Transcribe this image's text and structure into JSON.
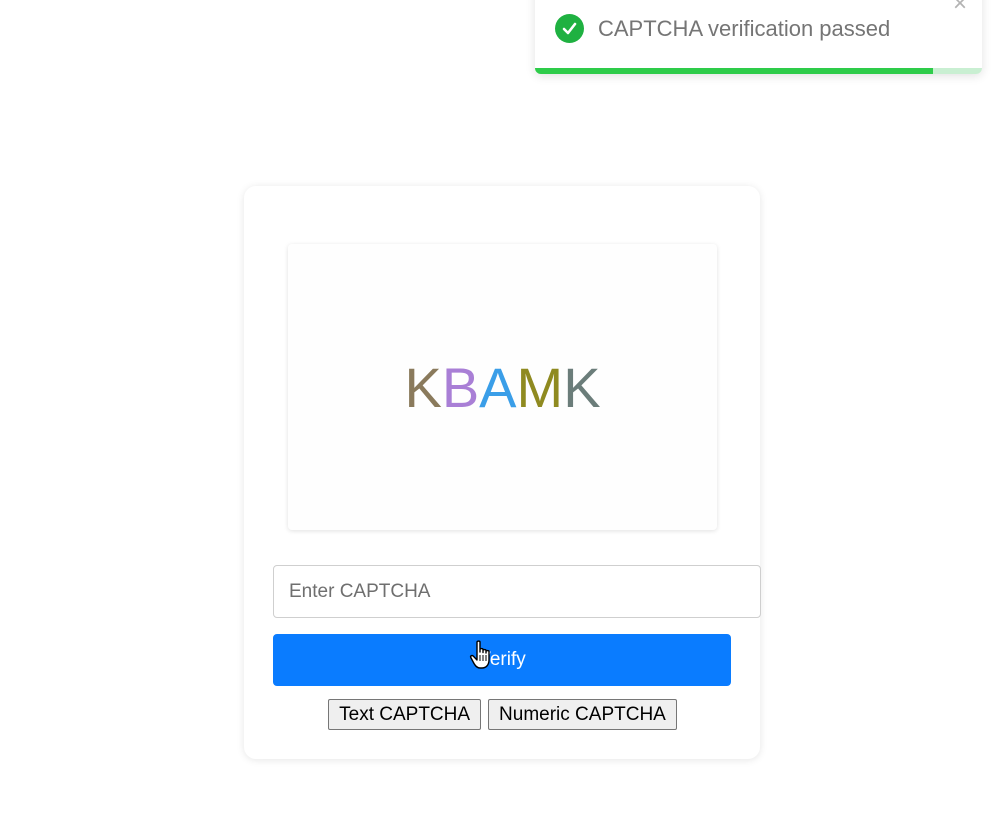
{
  "toast": {
    "message": "CAPTCHA verification passed",
    "close_symbol": "×",
    "icon": "check-circle-icon",
    "progress": 0.89,
    "colors": {
      "icon": "#1fb141",
      "progress": "#2ecc4a",
      "track": "#c9efd2"
    }
  },
  "captcha": {
    "chars": [
      {
        "char": "K",
        "color": "#8a7a5c"
      },
      {
        "char": "B",
        "color": "#a97fd6"
      },
      {
        "char": "A",
        "color": "#3a9ee8"
      },
      {
        "char": "M",
        "color": "#8f8a20"
      },
      {
        "char": "K",
        "color": "#6b7d7a"
      }
    ]
  },
  "input": {
    "placeholder": "Enter CAPTCHA",
    "value": ""
  },
  "verify_button": {
    "label": "Verify",
    "color": "#0a7cff"
  },
  "type_buttons": [
    {
      "label": "Text CAPTCHA"
    },
    {
      "label": "Numeric CAPTCHA"
    }
  ]
}
